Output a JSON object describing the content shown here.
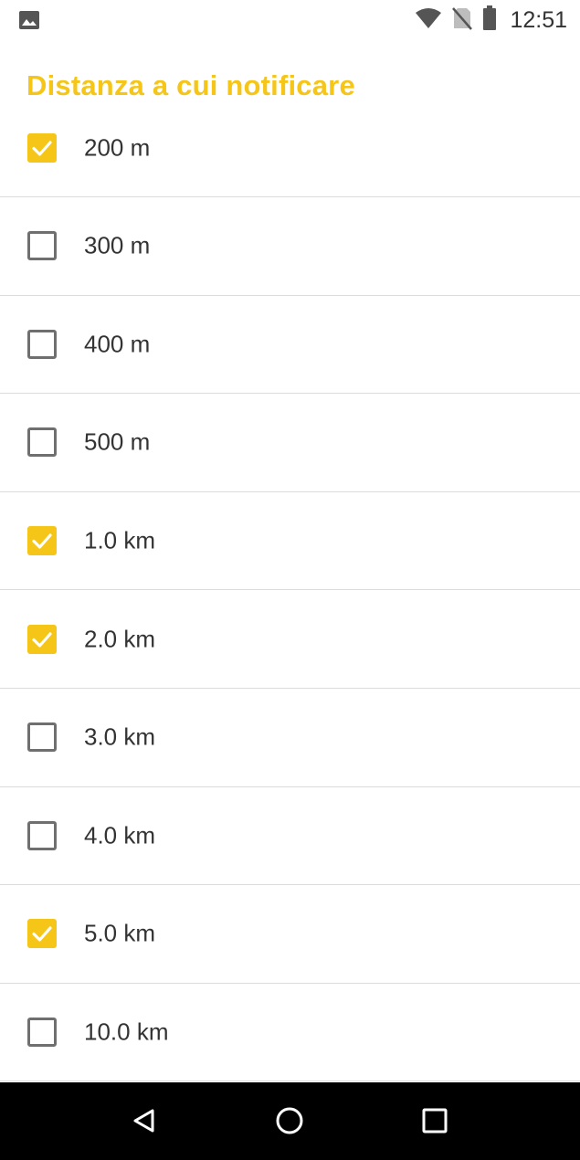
{
  "status_bar": {
    "time": "12:51",
    "icons": [
      "gallery-icon",
      "wifi-icon",
      "no-sim-icon",
      "battery-icon"
    ]
  },
  "title": "Distanza a cui notificare",
  "colors": {
    "accent": "#f5c518",
    "text": "#333333",
    "checkbox_border": "#6f6f6f",
    "divider": "#dcdcdc",
    "nav_bar": "#000000"
  },
  "options": [
    {
      "label": "200 m",
      "checked": true
    },
    {
      "label": "300 m",
      "checked": false
    },
    {
      "label": "400 m",
      "checked": false
    },
    {
      "label": "500 m",
      "checked": false
    },
    {
      "label": "1.0 km",
      "checked": true
    },
    {
      "label": "2.0 km",
      "checked": true
    },
    {
      "label": "3.0 km",
      "checked": false
    },
    {
      "label": "4.0 km",
      "checked": false
    },
    {
      "label": "5.0 km",
      "checked": true
    },
    {
      "label": "10.0 km",
      "checked": false
    }
  ],
  "nav_bar": {
    "buttons": [
      "back-icon",
      "home-icon",
      "recents-icon"
    ]
  }
}
